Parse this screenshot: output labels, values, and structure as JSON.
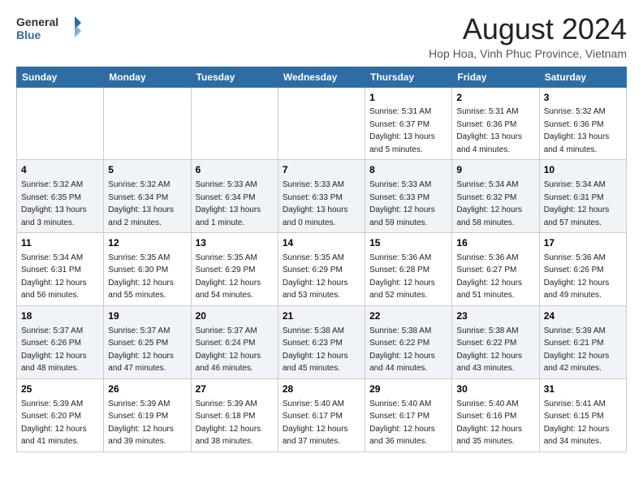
{
  "header": {
    "logo_general": "General",
    "logo_blue": "Blue",
    "main_title": "August 2024",
    "sub_title": "Hop Hoa, Vinh Phuc Province, Vietnam"
  },
  "days_of_week": [
    "Sunday",
    "Monday",
    "Tuesday",
    "Wednesday",
    "Thursday",
    "Friday",
    "Saturday"
  ],
  "weeks": [
    [
      {
        "day": "",
        "info": ""
      },
      {
        "day": "",
        "info": ""
      },
      {
        "day": "",
        "info": ""
      },
      {
        "day": "",
        "info": ""
      },
      {
        "day": "1",
        "info": "Sunrise: 5:31 AM\nSunset: 6:37 PM\nDaylight: 13 hours\nand 5 minutes."
      },
      {
        "day": "2",
        "info": "Sunrise: 5:31 AM\nSunset: 6:36 PM\nDaylight: 13 hours\nand 4 minutes."
      },
      {
        "day": "3",
        "info": "Sunrise: 5:32 AM\nSunset: 6:36 PM\nDaylight: 13 hours\nand 4 minutes."
      }
    ],
    [
      {
        "day": "4",
        "info": "Sunrise: 5:32 AM\nSunset: 6:35 PM\nDaylight: 13 hours\nand 3 minutes."
      },
      {
        "day": "5",
        "info": "Sunrise: 5:32 AM\nSunset: 6:34 PM\nDaylight: 13 hours\nand 2 minutes."
      },
      {
        "day": "6",
        "info": "Sunrise: 5:33 AM\nSunset: 6:34 PM\nDaylight: 13 hours\nand 1 minute."
      },
      {
        "day": "7",
        "info": "Sunrise: 5:33 AM\nSunset: 6:33 PM\nDaylight: 13 hours\nand 0 minutes."
      },
      {
        "day": "8",
        "info": "Sunrise: 5:33 AM\nSunset: 6:33 PM\nDaylight: 12 hours\nand 59 minutes."
      },
      {
        "day": "9",
        "info": "Sunrise: 5:34 AM\nSunset: 6:32 PM\nDaylight: 12 hours\nand 58 minutes."
      },
      {
        "day": "10",
        "info": "Sunrise: 5:34 AM\nSunset: 6:31 PM\nDaylight: 12 hours\nand 57 minutes."
      }
    ],
    [
      {
        "day": "11",
        "info": "Sunrise: 5:34 AM\nSunset: 6:31 PM\nDaylight: 12 hours\nand 56 minutes."
      },
      {
        "day": "12",
        "info": "Sunrise: 5:35 AM\nSunset: 6:30 PM\nDaylight: 12 hours\nand 55 minutes."
      },
      {
        "day": "13",
        "info": "Sunrise: 5:35 AM\nSunset: 6:29 PM\nDaylight: 12 hours\nand 54 minutes."
      },
      {
        "day": "14",
        "info": "Sunrise: 5:35 AM\nSunset: 6:29 PM\nDaylight: 12 hours\nand 53 minutes."
      },
      {
        "day": "15",
        "info": "Sunrise: 5:36 AM\nSunset: 6:28 PM\nDaylight: 12 hours\nand 52 minutes."
      },
      {
        "day": "16",
        "info": "Sunrise: 5:36 AM\nSunset: 6:27 PM\nDaylight: 12 hours\nand 51 minutes."
      },
      {
        "day": "17",
        "info": "Sunrise: 5:36 AM\nSunset: 6:26 PM\nDaylight: 12 hours\nand 49 minutes."
      }
    ],
    [
      {
        "day": "18",
        "info": "Sunrise: 5:37 AM\nSunset: 6:26 PM\nDaylight: 12 hours\nand 48 minutes."
      },
      {
        "day": "19",
        "info": "Sunrise: 5:37 AM\nSunset: 6:25 PM\nDaylight: 12 hours\nand 47 minutes."
      },
      {
        "day": "20",
        "info": "Sunrise: 5:37 AM\nSunset: 6:24 PM\nDaylight: 12 hours\nand 46 minutes."
      },
      {
        "day": "21",
        "info": "Sunrise: 5:38 AM\nSunset: 6:23 PM\nDaylight: 12 hours\nand 45 minutes."
      },
      {
        "day": "22",
        "info": "Sunrise: 5:38 AM\nSunset: 6:22 PM\nDaylight: 12 hours\nand 44 minutes."
      },
      {
        "day": "23",
        "info": "Sunrise: 5:38 AM\nSunset: 6:22 PM\nDaylight: 12 hours\nand 43 minutes."
      },
      {
        "day": "24",
        "info": "Sunrise: 5:39 AM\nSunset: 6:21 PM\nDaylight: 12 hours\nand 42 minutes."
      }
    ],
    [
      {
        "day": "25",
        "info": "Sunrise: 5:39 AM\nSunset: 6:20 PM\nDaylight: 12 hours\nand 41 minutes."
      },
      {
        "day": "26",
        "info": "Sunrise: 5:39 AM\nSunset: 6:19 PM\nDaylight: 12 hours\nand 39 minutes."
      },
      {
        "day": "27",
        "info": "Sunrise: 5:39 AM\nSunset: 6:18 PM\nDaylight: 12 hours\nand 38 minutes."
      },
      {
        "day": "28",
        "info": "Sunrise: 5:40 AM\nSunset: 6:17 PM\nDaylight: 12 hours\nand 37 minutes."
      },
      {
        "day": "29",
        "info": "Sunrise: 5:40 AM\nSunset: 6:17 PM\nDaylight: 12 hours\nand 36 minutes."
      },
      {
        "day": "30",
        "info": "Sunrise: 5:40 AM\nSunset: 6:16 PM\nDaylight: 12 hours\nand 35 minutes."
      },
      {
        "day": "31",
        "info": "Sunrise: 5:41 AM\nSunset: 6:15 PM\nDaylight: 12 hours\nand 34 minutes."
      }
    ]
  ]
}
